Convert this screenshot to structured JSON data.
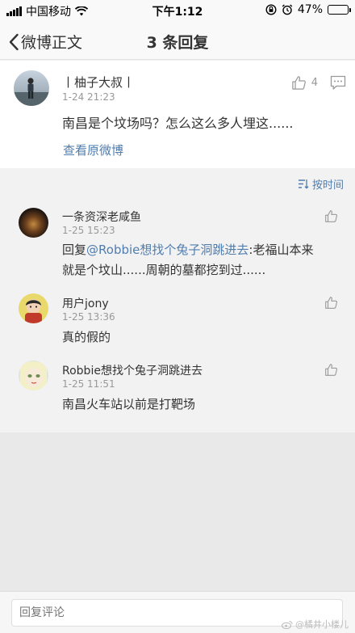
{
  "status_bar": {
    "carrier": "中国移动",
    "time": "下午1:12",
    "battery": "47%",
    "battery_level": 0.47
  },
  "nav": {
    "back_label": "微博正文",
    "title": "3 条回复"
  },
  "post": {
    "author": "丨柚子大叔丨",
    "time": "1-24 21:23",
    "like_count": "4",
    "text": "南昌是个坟场吗？怎么这么多人埋这......",
    "view_original": "查看原微博"
  },
  "sort_label": "按时间",
  "comments": [
    {
      "name": "一条资深老咸鱼",
      "time": "1-25 15:23",
      "reply_prefix": "回复",
      "mention": "@Robbie想找个兔子洞跳进去",
      "line1_rest": ":老福山本来",
      "line2": "就是个坟山......周朝的墓都挖到过......"
    },
    {
      "name": "用户jony",
      "time": "1-25 13:36",
      "text": "真的假的"
    },
    {
      "name": "Robbie想找个兔子洞跳进去",
      "time": "1-25 11:51",
      "text": "南昌火车站以前是打靶场"
    }
  ],
  "reply_placeholder": "回复评论",
  "watermark": "@橘井小楼儿",
  "colors": {
    "link": "#507daf",
    "background": "#f2f2f2",
    "card": "#ffffff"
  }
}
